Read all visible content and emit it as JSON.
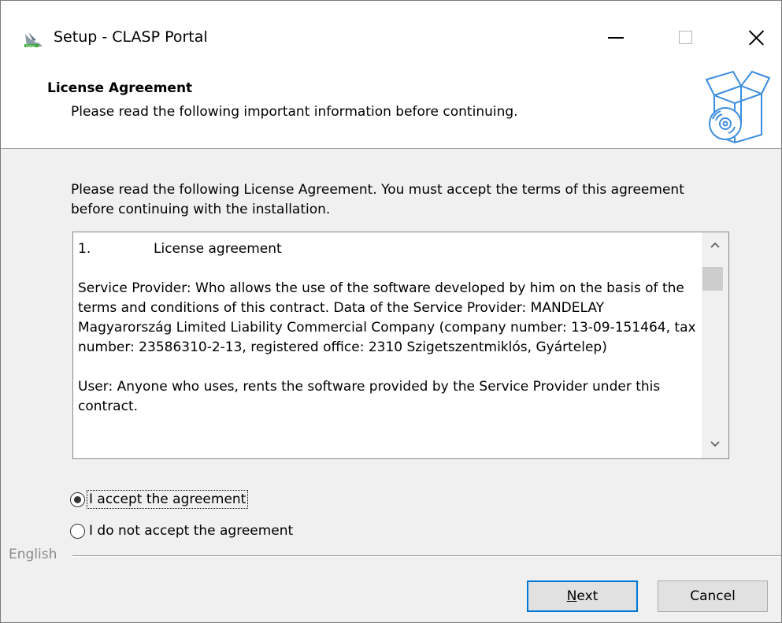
{
  "window": {
    "title": "Setup - CLASP Portal"
  },
  "header": {
    "title": "License Agreement",
    "subtitle": "Please read the following important information before continuing."
  },
  "intro": "Please read the following License Agreement. You must accept the terms of this agreement before continuing with the installation.",
  "license": {
    "heading_number": "1.",
    "heading_text": "License agreement",
    "paragraphs": [
      "Service Provider: Who allows the use of the software developed by him on the basis of the terms and conditions of this contract. Data of the Service Provider: MANDELAY Magyarország Limited Liability Commercial Company (company number: 13-09-151464, tax number: 23586310-2-13, registered office: 2310 Szigetszentmiklós, Gyártelep)",
      "User: Anyone who uses, rents the software provided by the Service Provider under this contract."
    ]
  },
  "options": {
    "accept": {
      "label": "I accept the agreement",
      "checked": true
    },
    "decline": {
      "label": "I do not accept the agreement",
      "checked": false
    }
  },
  "language": "English",
  "buttons": {
    "next": "Next",
    "cancel": "Cancel"
  },
  "colors": {
    "focus_border": "#0078d7",
    "icon_blue": "#3d8ee0"
  },
  "icons": [
    "setup-app-icon",
    "minimize-icon",
    "maximize-icon",
    "close-icon",
    "software-box-cd-icon",
    "scroll-up-icon",
    "scroll-down-icon"
  ]
}
